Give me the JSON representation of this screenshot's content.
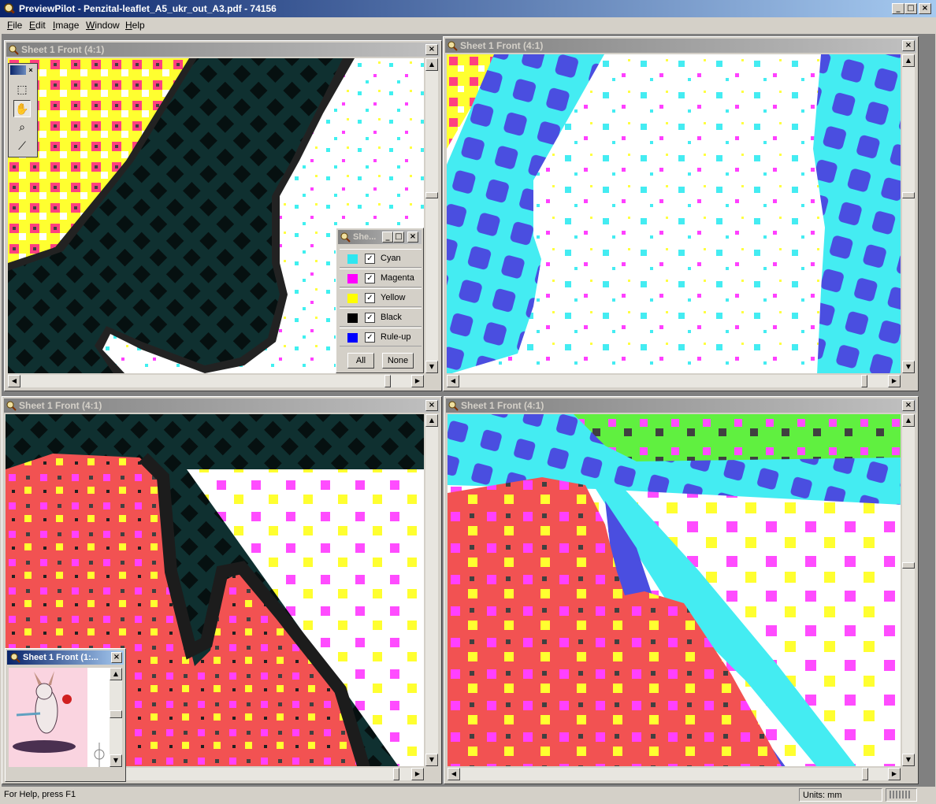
{
  "window": {
    "title": "PreviewPilot - Penzital-leaflet_A5_ukr_out_A3.pdf - 74156",
    "controls": [
      "minimize",
      "maximize",
      "close"
    ]
  },
  "menu": {
    "items": [
      {
        "key": "F",
        "rest": "ile"
      },
      {
        "key": "E",
        "rest": "dit"
      },
      {
        "key": "I",
        "rest": "mage"
      },
      {
        "key": "W",
        "rest": "indow"
      },
      {
        "key": "H",
        "rest": "elp"
      }
    ]
  },
  "views": [
    {
      "title": "Sheet 1 Front  (4:1)"
    },
    {
      "title": "Sheet 1 Front  (4:1)"
    },
    {
      "title": "Sheet 1 Front  (4:1)"
    },
    {
      "title": "Sheet 1 Front  (4:1)"
    }
  ],
  "toolbox": {
    "tools": [
      "marquee-select-icon",
      "hand-pan-icon",
      "zoom-magnifier-icon",
      "measure-icon"
    ],
    "active_tool": "hand-pan-icon"
  },
  "separations_panel": {
    "title": "She...",
    "separations": [
      {
        "name": "Cyan",
        "color": "#2ee6f0",
        "checked": true
      },
      {
        "name": "Magenta",
        "color": "#ff00ff",
        "checked": true
      },
      {
        "name": "Yellow",
        "color": "#ffff00",
        "checked": true
      },
      {
        "name": "Black",
        "color": "#000000",
        "checked": true
      },
      {
        "name": "Rule-up",
        "color": "#0000ff",
        "checked": true
      }
    ],
    "all_button": "All",
    "none_button": "None"
  },
  "overview": {
    "title": "Sheet 1 Front  (1:..."
  },
  "statusbar": {
    "help": "For Help, press F1",
    "units": "Units:  mm"
  },
  "colors": {
    "titlebar_active": "#0a246a",
    "titlebar_inactive": "#808080",
    "face": "#d4d0c8",
    "halftone_cyan": "#44ecf2",
    "halftone_blue": "#4a4ee0",
    "halftone_red": "#f25252",
    "halftone_dark": "#0f3030"
  }
}
